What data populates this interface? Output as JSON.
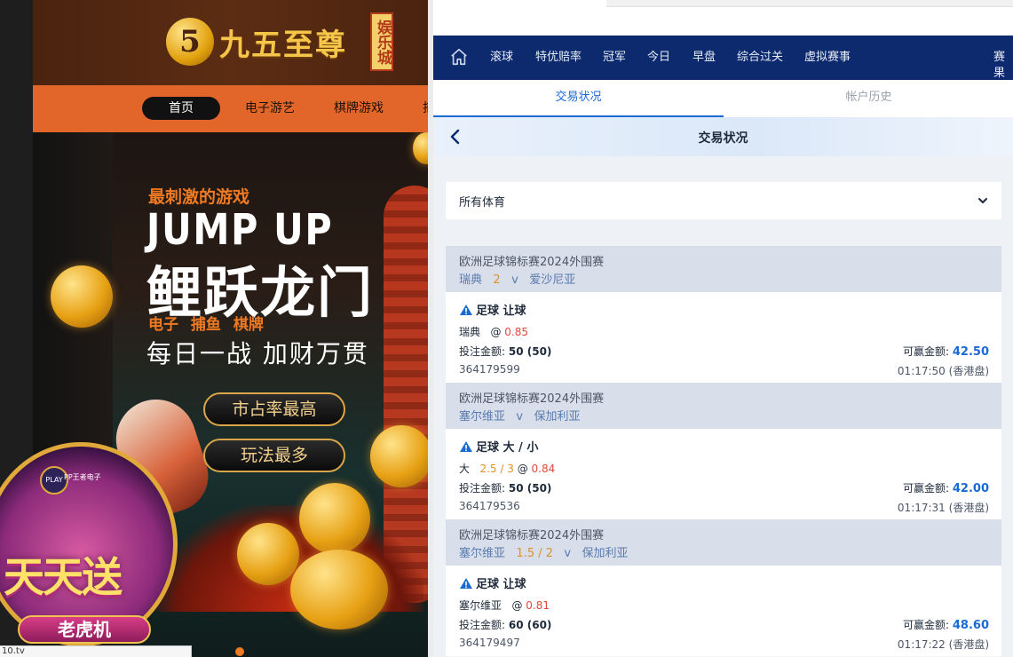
{
  "casino": {
    "logo_mark": "5",
    "logo_text": "九五至尊",
    "logo_badge": "娱乐城",
    "nav": [
      "首页",
      "电子游艺",
      "棋牌游戏",
      "捕"
    ],
    "banner": {
      "subtitle": "最刺激的游戏",
      "headline": "JUMP UP",
      "title": "鲤跃龙门",
      "categories": "电子 捕鱼 棋牌",
      "slogan": "每日一战 加财万贯",
      "button1": "市占率最高",
      "button2": "玩法最多"
    },
    "slot_promo": {
      "provider_badge": "PLAY",
      "provider_text": "PP王者电子",
      "title": "天天送",
      "subtitle": "老虎机"
    },
    "status_url": "10.tv"
  },
  "sportsbook": {
    "nav": [
      "滚球",
      "特优赔率",
      "冠军",
      "今日",
      "早盘",
      "综合过关",
      "虚拟赛事",
      "赛果"
    ],
    "tabs": {
      "active": "交易状况",
      "inactive": "帐户历史"
    },
    "page_title": "交易状况",
    "filter": "所有体育",
    "bets": [
      {
        "league": "欧洲足球锦标赛2024外围赛",
        "home": "瑞典",
        "handicap": "2",
        "vs": "v",
        "away": "爱沙尼亚",
        "market": "足球 让球",
        "selection": "瑞典",
        "sel_handicap": "",
        "odds_prefix": "@",
        "odds": "0.85",
        "stake_label": "投注金额:",
        "stake": "50 (50)",
        "win_label": "可赢金额:",
        "win": "42.50",
        "ticket": "364179599",
        "time": "01:17:50 (香港盘)"
      },
      {
        "league": "欧洲足球锦标赛2024外围赛",
        "home": "塞尔维亚",
        "handicap": "",
        "vs": "v",
        "away": "保加利亚",
        "market": "足球 大 / 小",
        "selection": "大",
        "sel_handicap": "2.5 / 3",
        "odds_prefix": "@",
        "odds": "0.84",
        "stake_label": "投注金额:",
        "stake": "50 (50)",
        "win_label": "可赢金额:",
        "win": "42.00",
        "ticket": "364179536",
        "time": "01:17:31 (香港盘)"
      },
      {
        "league": "欧洲足球锦标赛2024外围赛",
        "home": "塞尔维亚",
        "handicap": "1.5 / 2",
        "vs": "v",
        "away": "保加利亚",
        "market": "足球 让球",
        "selection": "塞尔维亚",
        "sel_handicap": "",
        "odds_prefix": "@",
        "odds": "0.81",
        "stake_label": "投注金额:",
        "stake": "60 (60)",
        "win_label": "可赢金额:",
        "win": "48.60",
        "ticket": "364179497",
        "time": "01:17:22 (香港盘)"
      }
    ]
  },
  "colors": {
    "casino_nav": "#e2652a",
    "sport_nav": "#0d2a6e",
    "accent_blue": "#1a6ad4",
    "handicap_orange": "#e0902a",
    "odds_red": "#e14a3b"
  }
}
